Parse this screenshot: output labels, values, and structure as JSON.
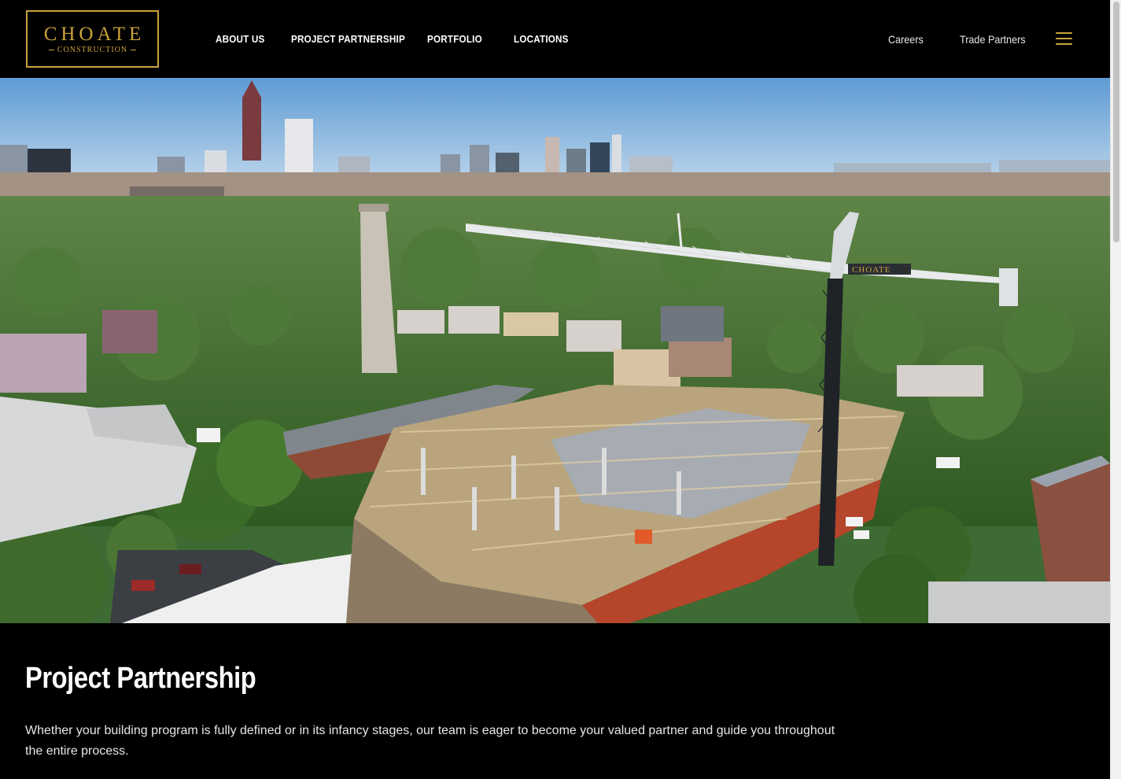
{
  "brand": {
    "logo_main": "CHOATE",
    "logo_sub": "CONSTRUCTION",
    "accent_color": "#c9a23a"
  },
  "nav": {
    "items": [
      {
        "label": "ABOUT US"
      },
      {
        "label": "PROJECT PARTNERSHIP"
      },
      {
        "label": "PORTFOLIO"
      },
      {
        "label": "LOCATIONS"
      }
    ],
    "utility": [
      {
        "label": "Careers"
      },
      {
        "label": "Trade Partners"
      }
    ],
    "menu_icon": "hamburger-menu-icon"
  },
  "hero": {
    "crane_sign": "CHOATE"
  },
  "content": {
    "title": "Project Partnership",
    "intro": "Whether your building program is fully defined or in its infancy stages, our team is eager to become your valued partner and guide you throughout the entire process."
  }
}
